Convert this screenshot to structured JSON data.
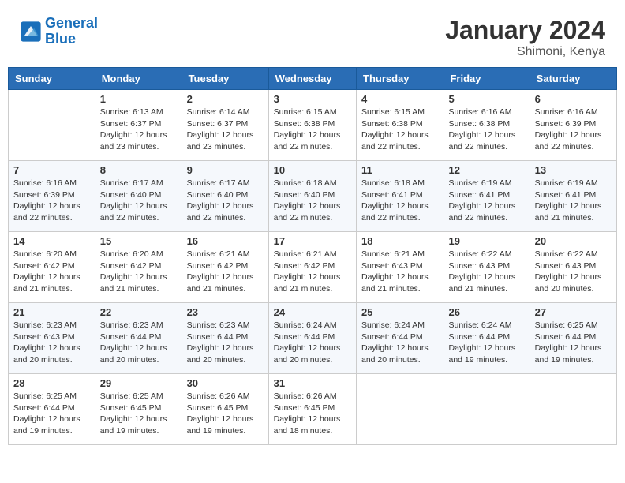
{
  "header": {
    "logo_line1": "General",
    "logo_line2": "Blue",
    "main_title": "January 2024",
    "subtitle": "Shimoni, Kenya"
  },
  "calendar": {
    "columns": [
      "Sunday",
      "Monday",
      "Tuesday",
      "Wednesday",
      "Thursday",
      "Friday",
      "Saturday"
    ],
    "weeks": [
      [
        {
          "day": "",
          "info": ""
        },
        {
          "day": "1",
          "info": "Sunrise: 6:13 AM\nSunset: 6:37 PM\nDaylight: 12 hours and 23 minutes."
        },
        {
          "day": "2",
          "info": "Sunrise: 6:14 AM\nSunset: 6:37 PM\nDaylight: 12 hours and 23 minutes."
        },
        {
          "day": "3",
          "info": "Sunrise: 6:15 AM\nSunset: 6:38 PM\nDaylight: 12 hours and 22 minutes."
        },
        {
          "day": "4",
          "info": "Sunrise: 6:15 AM\nSunset: 6:38 PM\nDaylight: 12 hours and 22 minutes."
        },
        {
          "day": "5",
          "info": "Sunrise: 6:16 AM\nSunset: 6:38 PM\nDaylight: 12 hours and 22 minutes."
        },
        {
          "day": "6",
          "info": "Sunrise: 6:16 AM\nSunset: 6:39 PM\nDaylight: 12 hours and 22 minutes."
        }
      ],
      [
        {
          "day": "7",
          "info": "Sunrise: 6:16 AM\nSunset: 6:39 PM\nDaylight: 12 hours and 22 minutes."
        },
        {
          "day": "8",
          "info": "Sunrise: 6:17 AM\nSunset: 6:40 PM\nDaylight: 12 hours and 22 minutes."
        },
        {
          "day": "9",
          "info": "Sunrise: 6:17 AM\nSunset: 6:40 PM\nDaylight: 12 hours and 22 minutes."
        },
        {
          "day": "10",
          "info": "Sunrise: 6:18 AM\nSunset: 6:40 PM\nDaylight: 12 hours and 22 minutes."
        },
        {
          "day": "11",
          "info": "Sunrise: 6:18 AM\nSunset: 6:41 PM\nDaylight: 12 hours and 22 minutes."
        },
        {
          "day": "12",
          "info": "Sunrise: 6:19 AM\nSunset: 6:41 PM\nDaylight: 12 hours and 22 minutes."
        },
        {
          "day": "13",
          "info": "Sunrise: 6:19 AM\nSunset: 6:41 PM\nDaylight: 12 hours and 21 minutes."
        }
      ],
      [
        {
          "day": "14",
          "info": "Sunrise: 6:20 AM\nSunset: 6:42 PM\nDaylight: 12 hours and 21 minutes."
        },
        {
          "day": "15",
          "info": "Sunrise: 6:20 AM\nSunset: 6:42 PM\nDaylight: 12 hours and 21 minutes."
        },
        {
          "day": "16",
          "info": "Sunrise: 6:21 AM\nSunset: 6:42 PM\nDaylight: 12 hours and 21 minutes."
        },
        {
          "day": "17",
          "info": "Sunrise: 6:21 AM\nSunset: 6:42 PM\nDaylight: 12 hours and 21 minutes."
        },
        {
          "day": "18",
          "info": "Sunrise: 6:21 AM\nSunset: 6:43 PM\nDaylight: 12 hours and 21 minutes."
        },
        {
          "day": "19",
          "info": "Sunrise: 6:22 AM\nSunset: 6:43 PM\nDaylight: 12 hours and 21 minutes."
        },
        {
          "day": "20",
          "info": "Sunrise: 6:22 AM\nSunset: 6:43 PM\nDaylight: 12 hours and 20 minutes."
        }
      ],
      [
        {
          "day": "21",
          "info": "Sunrise: 6:23 AM\nSunset: 6:43 PM\nDaylight: 12 hours and 20 minutes."
        },
        {
          "day": "22",
          "info": "Sunrise: 6:23 AM\nSunset: 6:44 PM\nDaylight: 12 hours and 20 minutes."
        },
        {
          "day": "23",
          "info": "Sunrise: 6:23 AM\nSunset: 6:44 PM\nDaylight: 12 hours and 20 minutes."
        },
        {
          "day": "24",
          "info": "Sunrise: 6:24 AM\nSunset: 6:44 PM\nDaylight: 12 hours and 20 minutes."
        },
        {
          "day": "25",
          "info": "Sunrise: 6:24 AM\nSunset: 6:44 PM\nDaylight: 12 hours and 20 minutes."
        },
        {
          "day": "26",
          "info": "Sunrise: 6:24 AM\nSunset: 6:44 PM\nDaylight: 12 hours and 19 minutes."
        },
        {
          "day": "27",
          "info": "Sunrise: 6:25 AM\nSunset: 6:44 PM\nDaylight: 12 hours and 19 minutes."
        }
      ],
      [
        {
          "day": "28",
          "info": "Sunrise: 6:25 AM\nSunset: 6:44 PM\nDaylight: 12 hours and 19 minutes."
        },
        {
          "day": "29",
          "info": "Sunrise: 6:25 AM\nSunset: 6:45 PM\nDaylight: 12 hours and 19 minutes."
        },
        {
          "day": "30",
          "info": "Sunrise: 6:26 AM\nSunset: 6:45 PM\nDaylight: 12 hours and 19 minutes."
        },
        {
          "day": "31",
          "info": "Sunrise: 6:26 AM\nSunset: 6:45 PM\nDaylight: 12 hours and 18 minutes."
        },
        {
          "day": "",
          "info": ""
        },
        {
          "day": "",
          "info": ""
        },
        {
          "day": "",
          "info": ""
        }
      ]
    ]
  }
}
